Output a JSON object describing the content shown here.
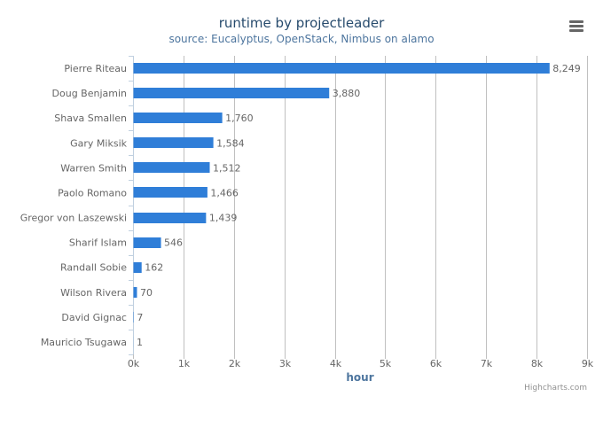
{
  "chart_data": {
    "type": "bar",
    "orientation": "horizontal",
    "title": "runtime by projectleader",
    "subtitle": "source: Eucalyptus, OpenStack, Nimbus on alamo",
    "xlabel": "",
    "ylabel": "hour",
    "categories": [
      "Pierre Riteau",
      "Doug Benjamin",
      "Shava Smallen",
      "Gary Miksik",
      "Warren Smith",
      "Paolo Romano",
      "Gregor von Laszewski",
      "Sharif Islam",
      "Randall Sobie",
      "Wilson Rivera",
      "David Gignac",
      "Mauricio Tsugawa"
    ],
    "series": [
      {
        "name": "runtime",
        "color": "#2f7ed8",
        "values": [
          8249,
          3880,
          1760,
          1584,
          1512,
          1466,
          1439,
          546,
          162,
          70,
          7,
          1
        ],
        "data_labels": [
          "8,249",
          "3,880",
          "1,760",
          "1,584",
          "1,512",
          "1,466",
          "1,439",
          "546",
          "162",
          "70",
          "7",
          "1"
        ]
      }
    ],
    "value_axis": {
      "range": [
        0,
        9000
      ],
      "ticks": [
        0,
        1000,
        2000,
        3000,
        4000,
        5000,
        6000,
        7000,
        8000,
        9000
      ],
      "tick_labels": [
        "0k",
        "1k",
        "2k",
        "3k",
        "4k",
        "5k",
        "6k",
        "7k",
        "8k",
        "9k"
      ],
      "title": "hour",
      "grid": true
    },
    "legend": "none"
  },
  "ui": {
    "menu_icon": "hamburger-menu-icon",
    "credits": "Highcharts.com"
  },
  "colors": {
    "bar": "#2f7ed8",
    "title": "#274b6d",
    "subtitle": "#4d759e",
    "axis_title": "#4d759e",
    "label": "#666666",
    "grid": "#c0c0c0",
    "axis_line": "#c0d0e0"
  }
}
